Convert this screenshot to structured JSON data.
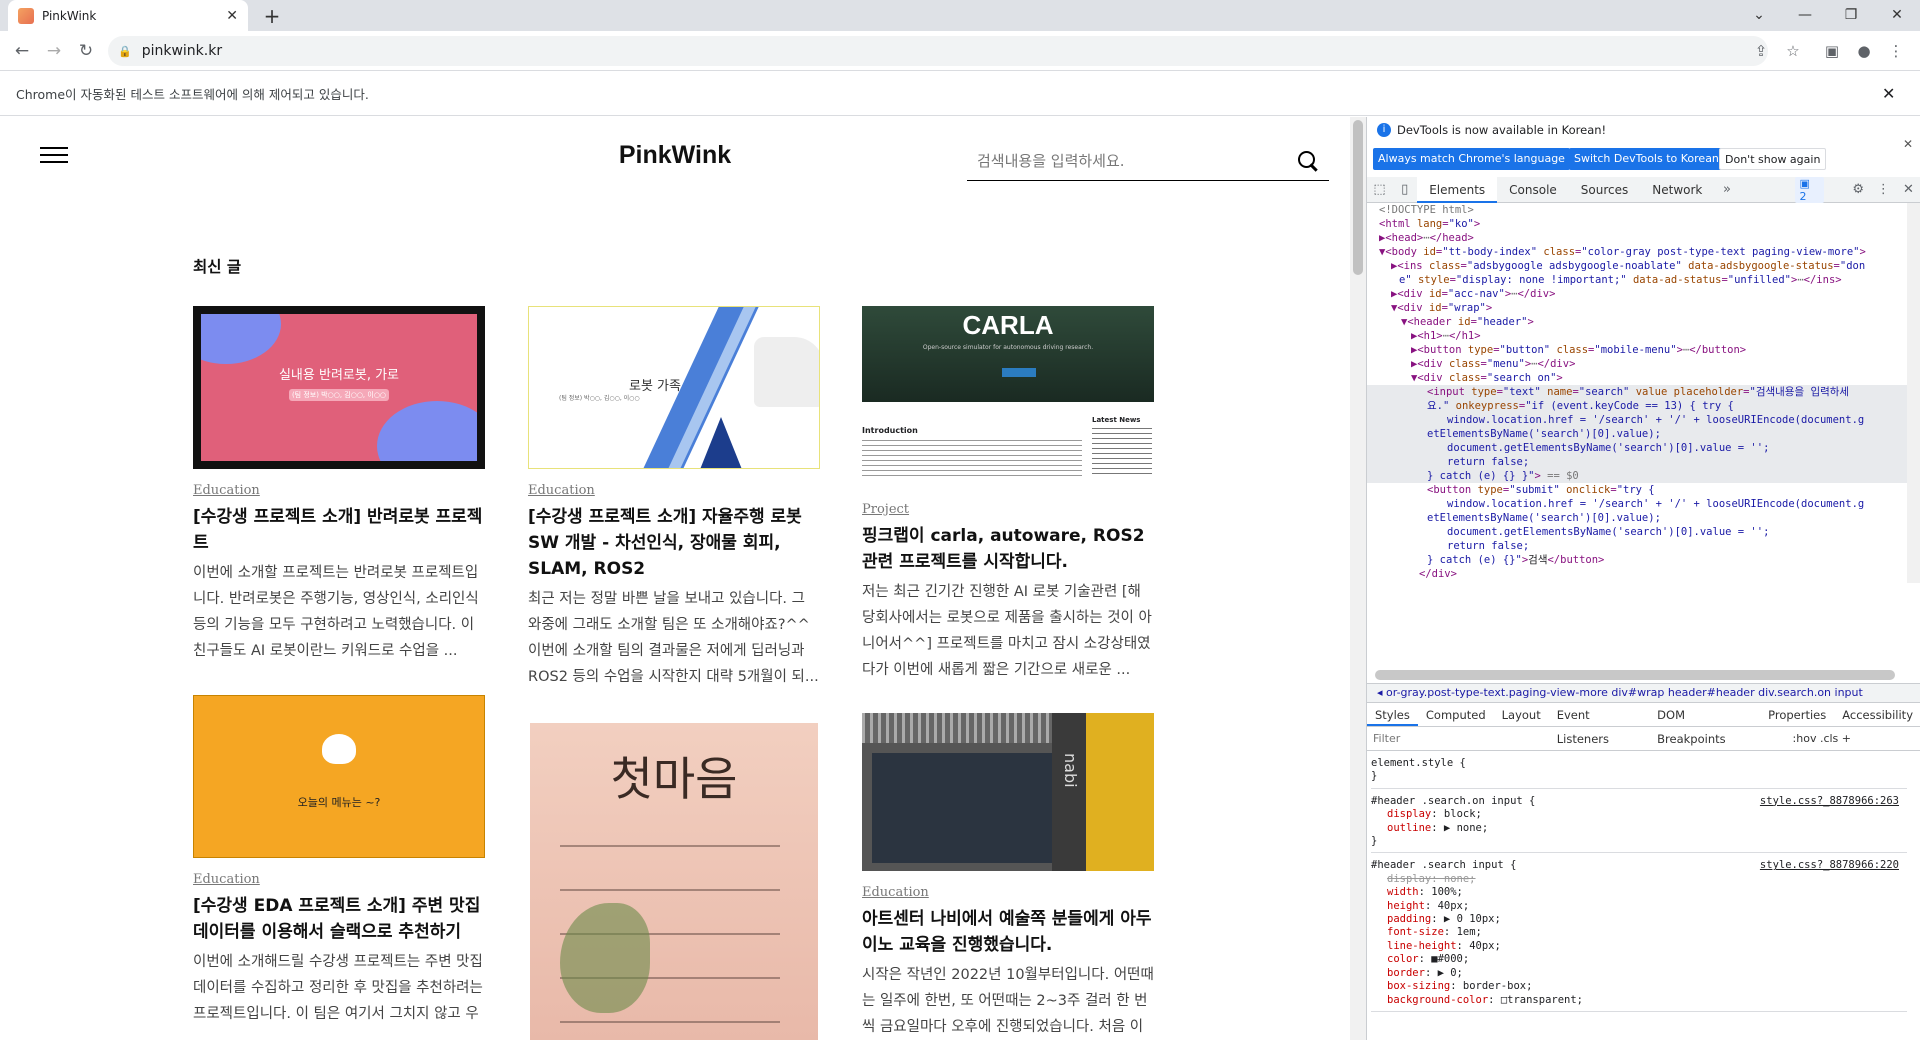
{
  "browser": {
    "tab_title": "PinkWink",
    "url": "pinkwink.kr",
    "automation_notice": "Chrome이 자동화된 테스트 소프트웨어에 의해 제어되고 있습니다."
  },
  "site": {
    "logo": "PinkWink",
    "search_placeholder": "검색내용을 입력하세요.",
    "section_title": "최신 글",
    "posts": [
      {
        "category": "Education",
        "title": "[수강생 프로젝트 소개] 반려로봇 프로젝트",
        "excerpt": "이번에 소개할 프로젝트는 반려로봇 프로젝트입니다. 반려로봇은 주행기능, 영상인식, 소리인식 등의 기능을 모두 구현하려고 노력했습니다. 이 친구들도 AI 로봇이란느 키워드로 수업을 ...",
        "thumb_text": "실내용 반려로봇, 가로",
        "thumb_sub": "(팀 정보) 박○○, 김○○, 이○○"
      },
      {
        "category": "Education",
        "title": "[수강생 프로젝트 소개] 자율주행 로봇 SW 개발 - 차선인식, 장애물 회피, SLAM, ROS2",
        "excerpt": "최근 저는 정말 바쁜 날을 보내고 있습니다. 그 와중에 그래도 소개할 팀은 또 소개해야죠?^^ 이번에 소개할 팀의 결과물은 저에게 딥러닝과 ROS2 등의 수업을 시작한지 대략 5개월이 되...",
        "thumb_text": "로봇 가족",
        "thumb_sub": "(팀 정보) 박○○, 김○○, 이○○"
      },
      {
        "category": "Project",
        "title": "핑크랩이 carla, autoware, ROS2 관련 프로젝트를 시작합니다.",
        "excerpt": "저는 최근 긴기간 진행한 AI 로봇 기술관련 [해당회사에서는 로봇으로 제품을 출시하는 것이 아니어서^^] 프로젝트를 마치고 잠시 소강상태였다가 이번에 새롭게 짧은 기간으로 새로운 ...",
        "thumb_text": "CARLA",
        "thumb_sub": "Open-source simulator for autonomous driving research.",
        "thumb_intro": "Introduction",
        "thumb_news": "Latest News"
      },
      {
        "category": "Education",
        "title": "[수강생 EDA 프로젝트 소개] 주변 맛집 데이터를 이용해서 슬랙으로 추천하기",
        "excerpt": "이번에 소개해드릴 수강생 프로젝트는 주변 맛집 데이터를 수집하고 정리한 후 맛집을 추천하려는 프로젝트입니다. 이 팀은 여기서 그치지 않고 우리가 많이 사용하는 슬랙에 직접 서비스",
        "thumb_text": "오늘의 메뉴는 ~?"
      },
      {
        "category": "",
        "title": "",
        "excerpt": "",
        "thumb_text": "첫마음"
      },
      {
        "category": "Education",
        "title": "아트센터 나비에서 예술쪽 분들에게 아두이노 교육을 진행했습니다.",
        "excerpt": "시작은 작년인 2022년 10월부터입니다. 어떤때는 일주에 한번, 또 어떤때는 2~3주 걸러 한 번씩 금요일마다 오후에 진행되었습니다. 처음 이",
        "thumb_text": "nabi"
      }
    ]
  },
  "devtools": {
    "banner": "DevTools is now available in Korean!",
    "btn_match": "Always match Chrome's language",
    "btn_switch": "Switch DevTools to Korean",
    "btn_dont": "Don't show again",
    "tabs": [
      "Elements",
      "Console",
      "Sources",
      "Network"
    ],
    "issues_count": "2",
    "breadcrumb": "◂ or-gray.post-type-text.paging-view-more   div#wrap   header#header   div.search.on   input",
    "style_tabs": [
      "Styles",
      "Computed",
      "Layout",
      "Event Listeners",
      "DOM Breakpoints",
      "Properties",
      "Accessibility"
    ],
    "filter_placeholder": "Filter",
    "filter_right": ":hov  .cls  +",
    "colors": {
      "accent": "#1a73e8",
      "tag": "#881280",
      "attr": "#994500",
      "value": "#1a1aa6"
    }
  }
}
